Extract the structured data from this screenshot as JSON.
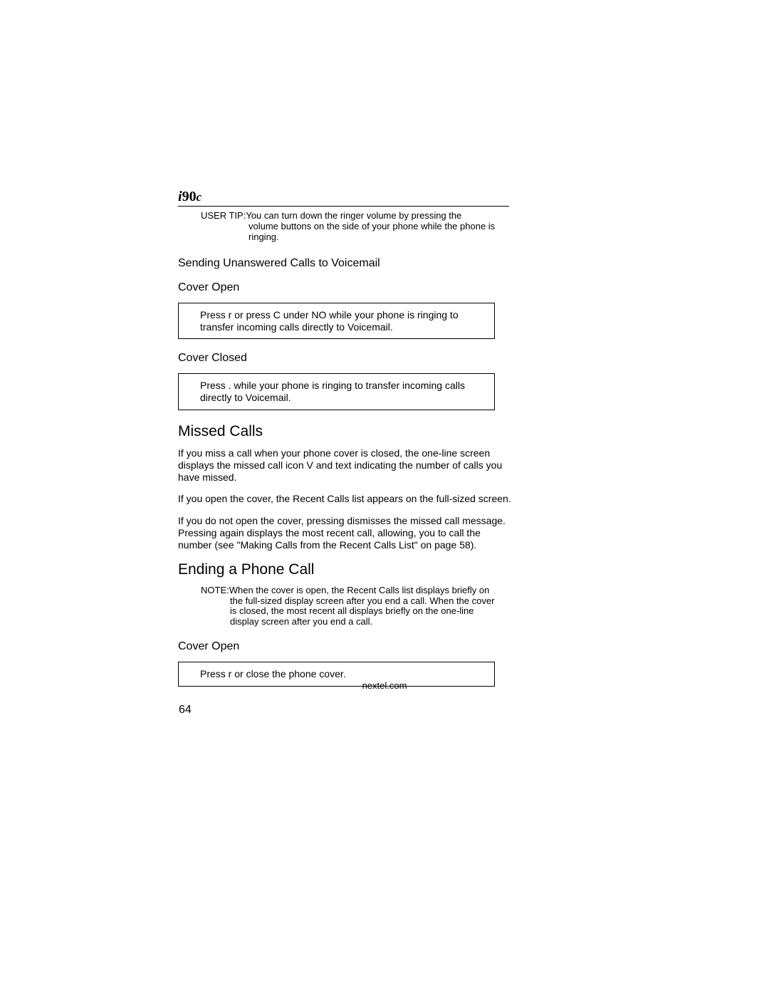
{
  "header": {
    "model_prefix": "i",
    "model_number": "90",
    "model_suffix": "c"
  },
  "tip": {
    "label": "USER TIP:",
    "line1": "You can turn down the ringer volume by pressing the",
    "line2": "volume buttons on the side of your phone while the phone is",
    "line3": "ringing."
  },
  "section1": {
    "title": "Sending Unanswered Calls to Voicemail",
    "sub_cover_open": "Cover Open",
    "box_open": "Press r  or press C  under NO while your phone is ringing to transfer incoming calls directly to Voicemail.",
    "sub_cover_closed": "Cover Closed",
    "box_closed": "Press .  while your phone is ringing to transfer incoming calls directly to Voicemail."
  },
  "section2": {
    "heading": "Missed Calls",
    "para1": "If you miss a call when your phone cover is closed, the one-line screen displays the missed call icon V  and text indicating the number of calls you have missed.",
    "para2_a": "If you open the cover, the ",
    "para2_b": "Recent Calls",
    "para2_c": " list appears on the full-sized screen.",
    "para3_a": "If you do not open the cover, pressing   dismisses the missed call message. Pressing   again displays the most recent call, allowing, you to call the number (see ",
    "para3_b": "\"Making Calls from the Recent Calls List\" on page 58",
    "para3_c": ")."
  },
  "section3": {
    "heading": "Ending a Phone Call",
    "note_label": "NOTE:",
    "note_line1": "When the cover is open, the Recent Calls list displays briefly on",
    "note_line2": "the full-sized display screen after you end a call. When the cover",
    "note_line3": "is closed, the most recent all displays briefly on the one-line",
    "note_line4": "display screen after you end a call.",
    "sub_cover_open": "Cover Open",
    "box_open": "Press r  or close the phone cover."
  },
  "footer": {
    "domain": "nextel.com",
    "page": "64"
  }
}
